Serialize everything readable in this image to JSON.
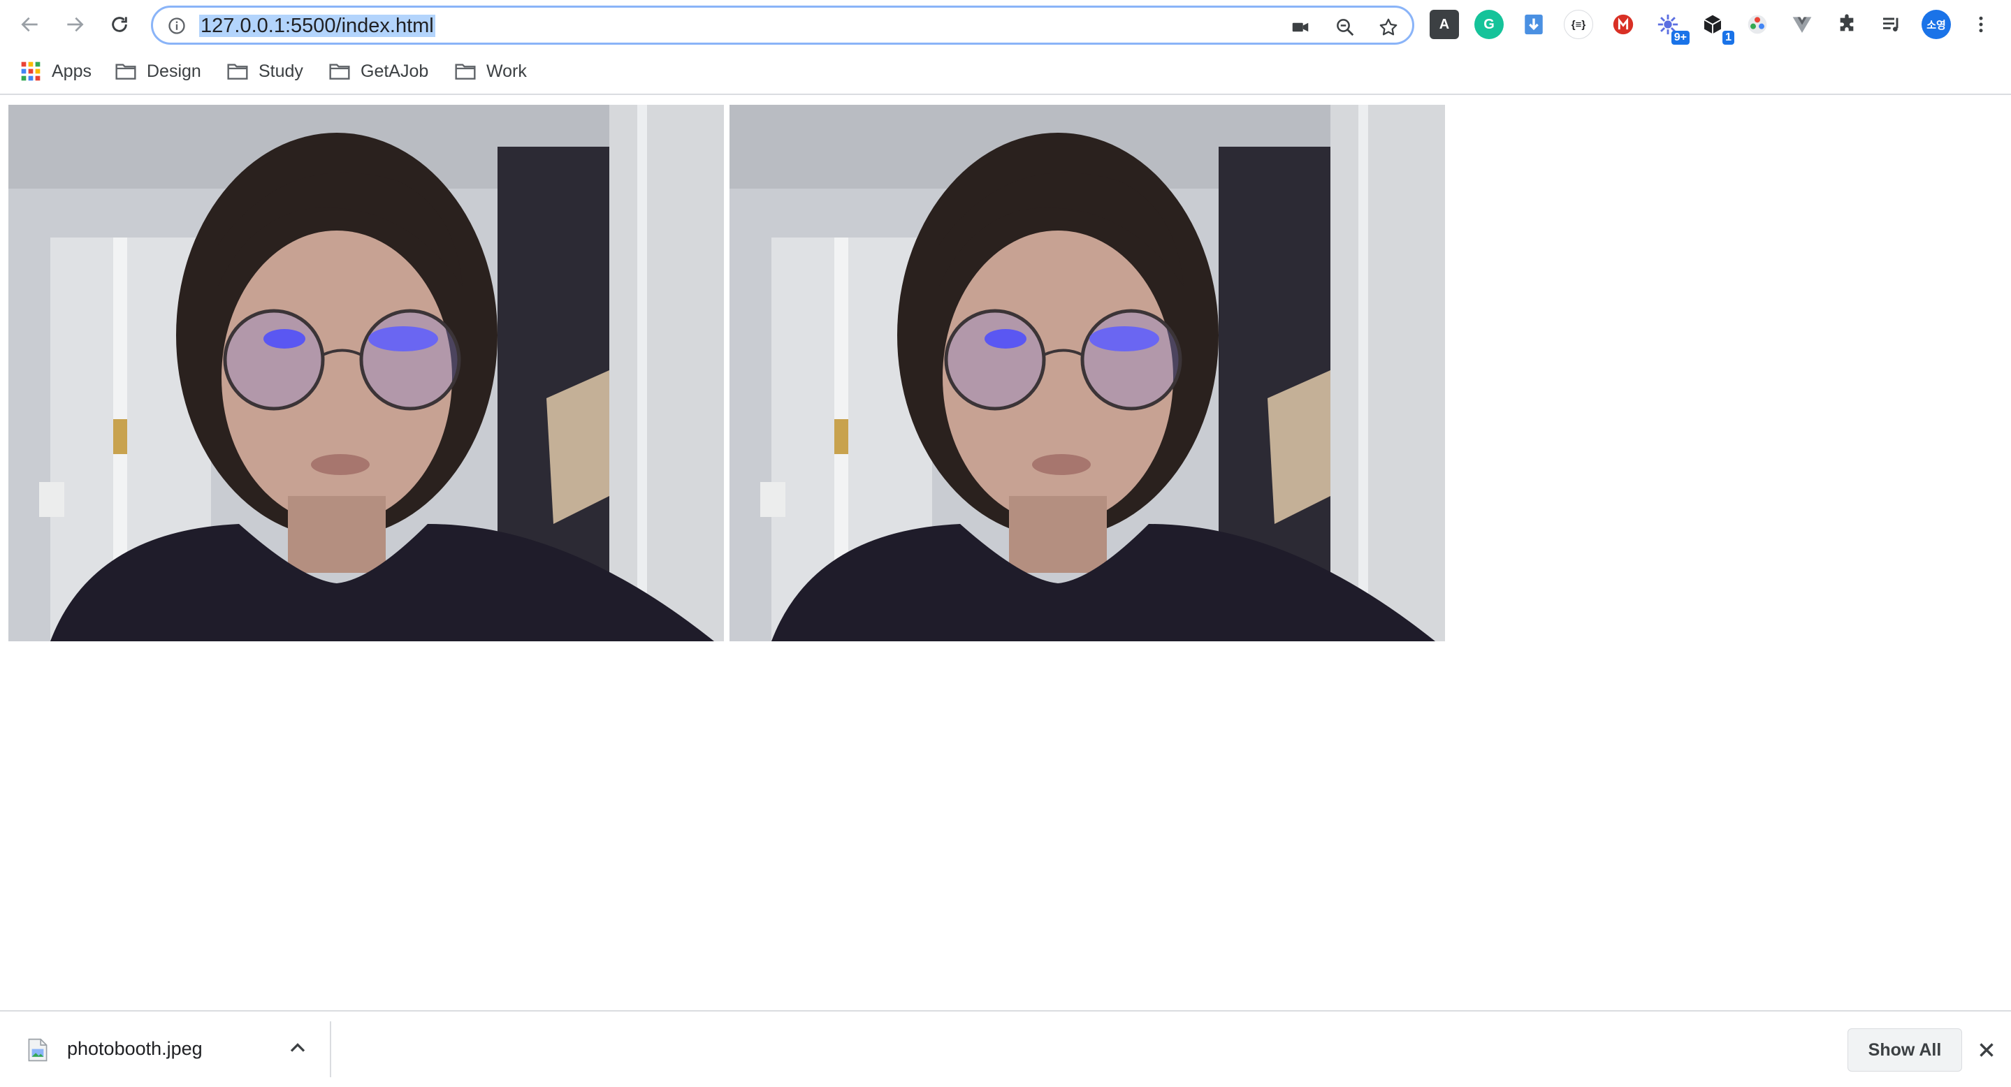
{
  "browser": {
    "url": "127.0.0.1:5500/index.html",
    "profile_initials": "소영",
    "extensions": [
      {
        "name": "dictionary-icon",
        "label": "A"
      },
      {
        "name": "grammarly-icon",
        "label": "G"
      },
      {
        "name": "download-arrow-icon",
        "label": ""
      },
      {
        "name": "json-viewer-icon",
        "label": "{≡}"
      },
      {
        "name": "red-ext-icon",
        "label": ""
      },
      {
        "name": "blue-ext-icon",
        "label": "",
        "badge": "9+"
      },
      {
        "name": "cube-ext-icon",
        "label": "",
        "badge": "1"
      },
      {
        "name": "color-picker-icon",
        "label": ""
      },
      {
        "name": "vue-devtools-icon",
        "label": ""
      },
      {
        "name": "puzzle-icon",
        "label": ""
      },
      {
        "name": "media-control-icon",
        "label": ""
      }
    ]
  },
  "bookmarks": [
    {
      "name": "bookmark-apps",
      "label": "Apps"
    },
    {
      "name": "bookmark-design",
      "label": "Design"
    },
    {
      "name": "bookmark-study",
      "label": "Study"
    },
    {
      "name": "bookmark-getajob",
      "label": "GetAJob"
    },
    {
      "name": "bookmark-work",
      "label": "Work"
    }
  ],
  "page": {
    "photos": [
      {
        "name": "webcam-video"
      },
      {
        "name": "captured-photo"
      }
    ]
  },
  "downloads": {
    "file_name": "photobooth.jpeg",
    "show_all_label": "Show All"
  },
  "colors": {
    "omnibox_focus": "#8ab4f8",
    "url_selection": "#b3d4fc",
    "profile_avatar": "#1a73e8"
  }
}
